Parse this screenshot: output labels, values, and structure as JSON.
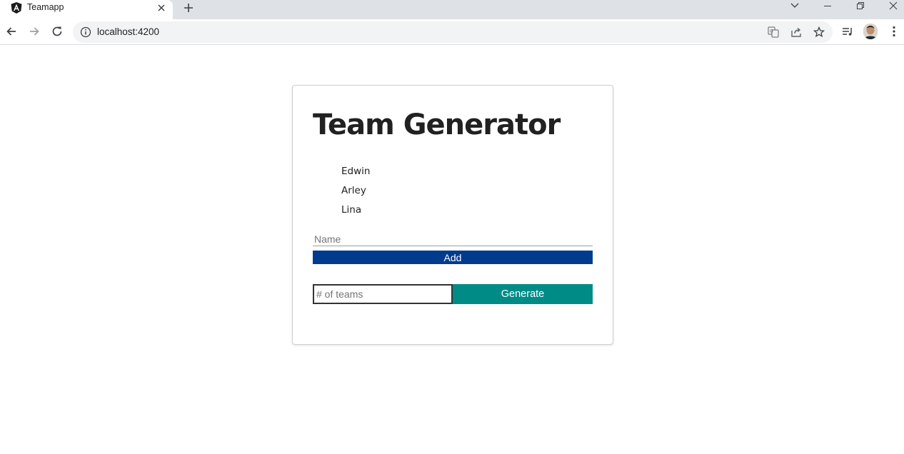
{
  "browser": {
    "tab_title": "Teamapp",
    "url": "localhost:4200"
  },
  "page": {
    "title": "Team Generator",
    "members": [
      "Edwin",
      "Arley",
      "Lina"
    ],
    "name_input": {
      "placeholder": "Name",
      "value": ""
    },
    "add_label": "Add",
    "teams_input": {
      "placeholder": "# of teams",
      "value": ""
    },
    "generate_label": "Generate"
  },
  "colors": {
    "add_button": "#003b8e",
    "generate_button": "#008b87"
  },
  "icons": {
    "favicon": "angular-logo-icon",
    "tab_close": "close-icon",
    "new_tab": "plus-icon",
    "back": "arrow-left-icon",
    "forward": "arrow-right-icon",
    "reload": "reload-icon",
    "site_info": "info-icon",
    "translate": "translate-icon",
    "share": "share-icon",
    "bookmark": "star-icon",
    "reading_list": "reading-list-icon",
    "menu": "kebab-menu-icon"
  }
}
